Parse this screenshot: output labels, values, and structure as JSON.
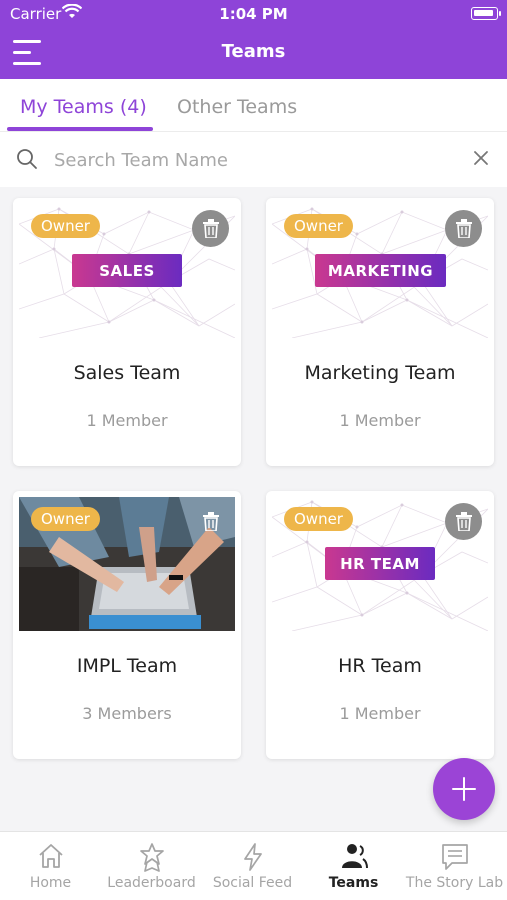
{
  "status": {
    "carrier": "Carrier",
    "time": "1:04 PM"
  },
  "header": {
    "title": "Teams"
  },
  "tabs": [
    {
      "label": "My Teams (4)",
      "active": true
    },
    {
      "label": "Other Teams",
      "active": false
    }
  ],
  "search": {
    "placeholder": "Search Team Name",
    "value": ""
  },
  "teams": [
    {
      "role": "Owner",
      "badge": "SALES",
      "name": "Sales Team",
      "members": "1 Member",
      "image": "network-pattern"
    },
    {
      "role": "Owner",
      "badge": "MARKETING",
      "name": "Marketing Team",
      "members": "1 Member",
      "image": "network-pattern"
    },
    {
      "role": "Owner",
      "badge": "",
      "name": "IMPL Team",
      "members": "3 Members",
      "image": "team-hands-laptop-photo"
    },
    {
      "role": "Owner",
      "badge": "HR TEAM",
      "name": "HR Team",
      "members": "1 Member",
      "image": "network-pattern"
    }
  ],
  "fab": {
    "icon": "plus-icon"
  },
  "bottom_nav": [
    {
      "label": "Home",
      "icon": "home-icon",
      "active": false
    },
    {
      "label": "Leaderboard",
      "icon": "award-icon",
      "active": false
    },
    {
      "label": "Social Feed",
      "icon": "lightning-icon",
      "active": false
    },
    {
      "label": "Teams",
      "icon": "team-icon",
      "active": true
    },
    {
      "label": "The Story Lab",
      "icon": "chat-icon",
      "active": false
    }
  ],
  "colors": {
    "primary": "#8e44d8",
    "owner_badge": "#eeb64a",
    "trash": "#8d8d8d",
    "badge_gradient_start": "#c93890",
    "badge_gradient_end": "#6b2bc0"
  }
}
